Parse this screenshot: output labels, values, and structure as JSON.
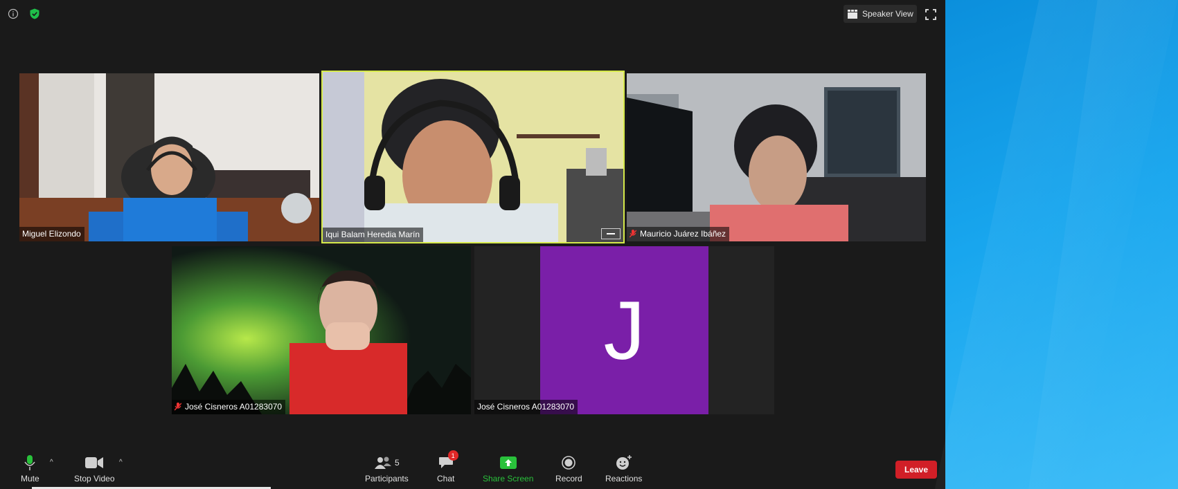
{
  "header": {
    "info_icon": "info-icon",
    "security_icon": "shield-check-icon",
    "security_color": "#1fbf4a",
    "speaker_view_label": "Speaker View",
    "fullscreen_icon": "fullscreen-icon"
  },
  "participants": [
    {
      "name": "Miguel Elizondo",
      "muted": false,
      "video": true
    },
    {
      "name": "Iqui Balam Heredia Marín",
      "muted": false,
      "video": true,
      "active_speaker": true
    },
    {
      "name": "Mauricio Juárez Ibáñez",
      "muted": true,
      "video": true
    },
    {
      "name": "José Cisneros A01283070",
      "muted": true,
      "video": true
    },
    {
      "name": "José Cisneros A01283070",
      "muted": false,
      "video": false,
      "avatar_letter": "J",
      "avatar_color": "#7a1fa8"
    }
  ],
  "toolbar": {
    "mute_label": "Mute",
    "stop_video_label": "Stop Video",
    "participants_label": "Participants",
    "participants_count": "5",
    "chat_label": "Chat",
    "chat_badge": "1",
    "share_screen_label": "Share Screen",
    "share_color": "#29c13b",
    "record_label": "Record",
    "reactions_label": "Reactions",
    "leave_label": "Leave",
    "leave_color": "#d11f27"
  },
  "colors": {
    "active_speaker_border": "#d6ea4a",
    "background": "#1a1a1a",
    "desktop": "#18a6ee"
  }
}
